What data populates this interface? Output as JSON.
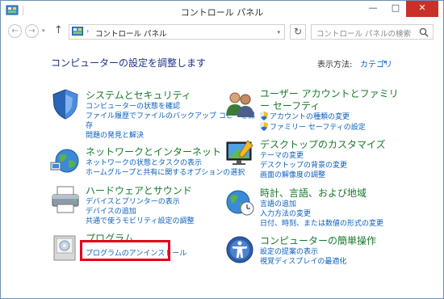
{
  "window": {
    "title": "コントロール パネル",
    "controls": {
      "minimize": "—",
      "maximize": "□",
      "close": "✕"
    }
  },
  "nav": {
    "back": "←",
    "forward": "→",
    "dropdown": "▾",
    "up": "↑",
    "breadcrumb_separator": "›",
    "address": "コントロール パネル",
    "address_dropdown": "▾",
    "refresh": "↻",
    "search_placeholder": "コントロール パネルの検索"
  },
  "content": {
    "heading": "コンピューターの設定を調整します",
    "view_by_label": "表示方法:",
    "view_by_value": "カテゴリ",
    "view_by_caret": "▾"
  },
  "categories": [
    {
      "icon": "shield-security-icon",
      "title": "システムとセキュリティ",
      "links": [
        "コンピューターの状態を確認",
        "ファイル履歴でファイルのバックアップ コピーを保",
        "存",
        "問題の発見と解決"
      ]
    },
    {
      "icon": "network-globe-icon",
      "title": "ネットワークとインターネット",
      "links": [
        "ネットワークの状態とタスクの表示",
        "ホームグループと共有に関するオプションの選択"
      ]
    },
    {
      "icon": "printer-hardware-icon",
      "title": "ハードウェアとサウンド",
      "links": [
        "デバイスとプリンターの表示",
        "デバイスの追加",
        "共通で使うモビリティ設定の調整"
      ]
    },
    {
      "icon": "programs-icon",
      "title": "プログラム",
      "links": [
        "プログラムのアンインストール"
      ]
    },
    {
      "icon": "users-icon",
      "title": "ユーザー アカウントとファミリー セーフティ",
      "links": [
        "アカウントの種類の変更",
        "ファミリー セーフティの設定"
      ]
    },
    {
      "icon": "desktop-customize-icon",
      "title": "デスクトップのカスタマイズ",
      "links": [
        "テーマの変更",
        "デスクトップの背景の変更",
        "画面の解像度の調整"
      ]
    },
    {
      "icon": "clock-globe-icon",
      "title": "時計、言語、および地域",
      "links": [
        "言語の追加",
        "入力方法の変更",
        "日付、時刻、または数値の形式の変更"
      ]
    },
    {
      "icon": "ease-of-access-icon",
      "title": "コンピューターの簡単操作",
      "links": [
        "設定の提案の表示",
        "視覚ディスプレイの最適化"
      ]
    }
  ],
  "colors": {
    "category_title": "#177a2c",
    "link": "#0a5fbf",
    "heading": "#1e3287",
    "highlight": "#e3001b"
  }
}
